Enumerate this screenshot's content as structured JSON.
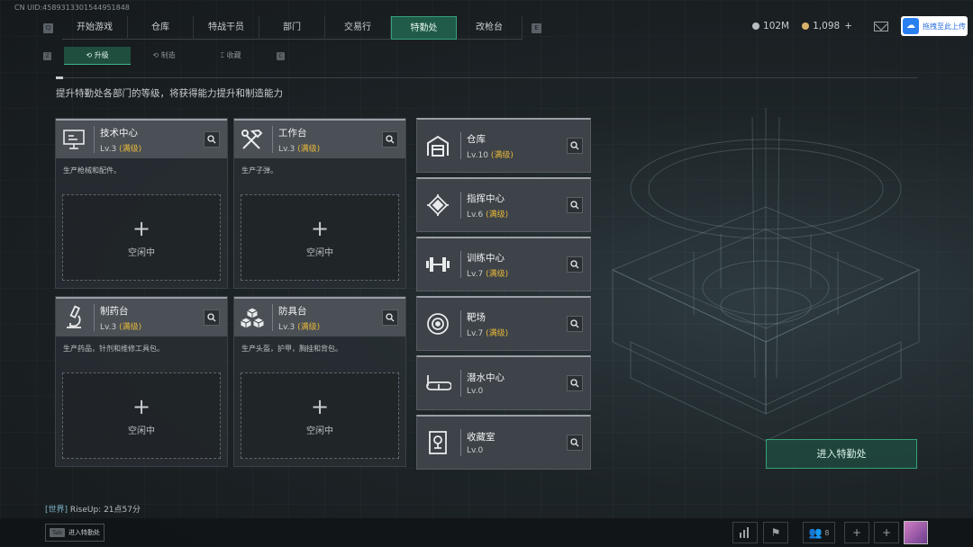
{
  "uid": "CN UID:4589313301544951848",
  "nav": {
    "left_key": "Q",
    "right_key": "E",
    "tabs": [
      {
        "label": "开始游戏"
      },
      {
        "label": "仓库"
      },
      {
        "label": "特战干员"
      },
      {
        "label": "部门"
      },
      {
        "label": "交易行"
      },
      {
        "label": "特勤处"
      },
      {
        "label": "改枪台"
      }
    ],
    "active_index": 5
  },
  "currency": {
    "silver": "102M",
    "gold": "1,098",
    "gold_plus": "+"
  },
  "upload_button": "拖拽至此上传",
  "subnav": {
    "left_key": "Z",
    "right_key": "C",
    "tabs": [
      {
        "label": "升级",
        "icon": "upgrade-icon"
      },
      {
        "label": "制造",
        "icon": "craft-icon"
      },
      {
        "label": "收藏",
        "icon": "collection-icon"
      }
    ]
  },
  "description": "提升特勤处各部门的等级，将获得能力提升和制造能力",
  "departments": [
    {
      "name": "技术中心",
      "level": "Lv.3",
      "max": "(满级)",
      "desc": "生产枪械和配件。",
      "slot_plus": "+",
      "slot_status": "空闲中",
      "icon": "computer-icon"
    },
    {
      "name": "工作台",
      "level": "Lv.3",
      "max": "(满级)",
      "desc": "生产子弹。",
      "slot_plus": "+",
      "slot_status": "空闲中",
      "icon": "tools-icon"
    },
    {
      "name": "制药台",
      "level": "Lv.3",
      "max": "(满级)",
      "desc": "生产药品，针剂和维修工具包。",
      "slot_plus": "+",
      "slot_status": "空闲中",
      "icon": "microscope-icon"
    },
    {
      "name": "防具台",
      "level": "Lv.3",
      "max": "(满级)",
      "desc": "生产头盔，护甲，胸挂和背包。",
      "slot_plus": "+",
      "slot_status": "空闲中",
      "icon": "armor-cubes-icon"
    }
  ],
  "facilities": [
    {
      "name": "仓库",
      "level": "Lv.10",
      "max": "(满级)",
      "icon": "warehouse-icon"
    },
    {
      "name": "指挥中心",
      "level": "Lv.6",
      "max": "(满级)",
      "icon": "chip-icon"
    },
    {
      "name": "训练中心",
      "level": "Lv.7",
      "max": "(满级)",
      "icon": "dumbbell-icon"
    },
    {
      "name": "靶场",
      "level": "Lv.7",
      "max": "(满级)",
      "icon": "target-icon"
    },
    {
      "name": "潜水中心",
      "level": "Lv.0",
      "max": "",
      "icon": "diving-mask-icon"
    },
    {
      "name": "收藏室",
      "level": "Lv.0",
      "max": "",
      "icon": "trophy-room-icon"
    }
  ],
  "enter_button": "进入特勤处",
  "chat": {
    "channel": "[世界]",
    "message": "RiseUp: 21点57分"
  },
  "bottom": {
    "tab_key": "Tab",
    "tab_hint": "进入特勤处",
    "friends_count": "8",
    "plus": "+"
  },
  "colors": {
    "accent": "#1f5b48",
    "accent_border": "#38a07a",
    "max_level": "#e7b73a"
  }
}
